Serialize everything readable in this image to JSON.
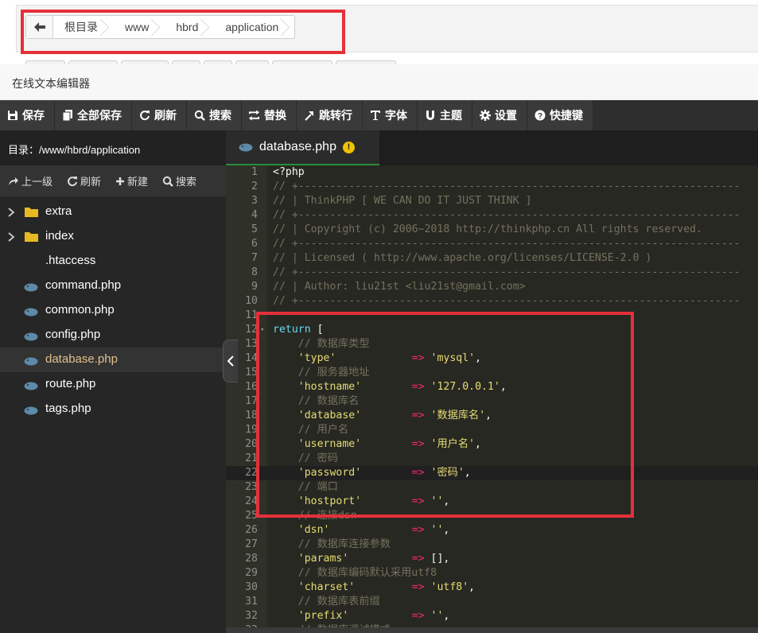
{
  "breadcrumb": {
    "items": [
      "根目录",
      "www",
      "hbrd",
      "application"
    ]
  },
  "window": {
    "title": "在线文本编辑器"
  },
  "toolbar": {
    "buttons": [
      {
        "label": "保存",
        "icon": "floppy-icon"
      },
      {
        "label": "全部保存",
        "icon": "files-icon"
      },
      {
        "label": "刷新",
        "icon": "refresh-icon"
      },
      {
        "label": "搜索",
        "icon": "search-icon"
      },
      {
        "label": "替换",
        "icon": "replace-icon"
      },
      {
        "label": "跳转行",
        "icon": "jump-icon"
      },
      {
        "label": "字体",
        "icon": "font-icon"
      },
      {
        "label": "主题",
        "icon": "magnet-icon"
      },
      {
        "label": "设置",
        "icon": "gear-icon"
      },
      {
        "label": "快捷键",
        "icon": "help-icon"
      }
    ]
  },
  "sidebar": {
    "path": "目录：/www/hbrd/application",
    "actions": [
      {
        "label": "上一级",
        "icon": "share-icon"
      },
      {
        "label": "刷新",
        "icon": "refresh-icon"
      },
      {
        "label": "新建",
        "icon": "plus-icon"
      },
      {
        "label": "搜索",
        "icon": "search-icon"
      }
    ],
    "files": [
      {
        "name": "extra",
        "type": "folder",
        "active": false
      },
      {
        "name": "index",
        "type": "folder",
        "active": false
      },
      {
        "name": ".htaccess",
        "type": "file",
        "active": false
      },
      {
        "name": "command.php",
        "type": "php",
        "active": false
      },
      {
        "name": "common.php",
        "type": "php",
        "active": false
      },
      {
        "name": "config.php",
        "type": "php",
        "active": false
      },
      {
        "name": "database.php",
        "type": "php",
        "active": true
      },
      {
        "name": "route.php",
        "type": "php",
        "active": false
      },
      {
        "name": "tags.php",
        "type": "php",
        "active": false
      }
    ]
  },
  "editor": {
    "tab_name": "database.php",
    "current_line": 22,
    "lines": [
      {
        "n": 1,
        "fold": false,
        "tokens": [
          {
            "t": "pl",
            "v": "<?php"
          }
        ]
      },
      {
        "n": 2,
        "fold": false,
        "tokens": [
          {
            "t": "com",
            "v": "// +----------------------------------------------------------------------"
          }
        ]
      },
      {
        "n": 3,
        "fold": false,
        "tokens": [
          {
            "t": "com",
            "v": "// | ThinkPHP [ WE CAN DO IT JUST THINK ]"
          }
        ]
      },
      {
        "n": 4,
        "fold": false,
        "tokens": [
          {
            "t": "com",
            "v": "// +----------------------------------------------------------------------"
          }
        ]
      },
      {
        "n": 5,
        "fold": false,
        "tokens": [
          {
            "t": "com",
            "v": "// | Copyright (c) 2006~2018 http://thinkphp.cn All rights reserved."
          }
        ]
      },
      {
        "n": 6,
        "fold": false,
        "tokens": [
          {
            "t": "com",
            "v": "// +----------------------------------------------------------------------"
          }
        ]
      },
      {
        "n": 7,
        "fold": false,
        "tokens": [
          {
            "t": "com",
            "v": "// | Licensed ( http://www.apache.org/licenses/LICENSE-2.0 )"
          }
        ]
      },
      {
        "n": 8,
        "fold": false,
        "tokens": [
          {
            "t": "com",
            "v": "// +----------------------------------------------------------------------"
          }
        ]
      },
      {
        "n": 9,
        "fold": false,
        "tokens": [
          {
            "t": "com",
            "v": "// | Author: liu21st <liu21st@gmail.com>"
          }
        ]
      },
      {
        "n": 10,
        "fold": false,
        "tokens": [
          {
            "t": "com",
            "v": "// +----------------------------------------------------------------------"
          }
        ]
      },
      {
        "n": 11,
        "fold": false,
        "tokens": []
      },
      {
        "n": 12,
        "fold": true,
        "tokens": [
          {
            "t": "kw",
            "v": "return"
          },
          {
            "t": "pl",
            "v": " ["
          }
        ]
      },
      {
        "n": 13,
        "fold": false,
        "tokens": [
          {
            "t": "com",
            "v": "    // 数据库类型"
          }
        ]
      },
      {
        "n": 14,
        "fold": false,
        "tokens": [
          {
            "t": "str",
            "v": "    'type'"
          },
          {
            "t": "pl",
            "v": "            "
          },
          {
            "t": "op",
            "v": "=>"
          },
          {
            "t": "pl",
            "v": " "
          },
          {
            "t": "str",
            "v": "'mysql'"
          },
          {
            "t": "pl",
            "v": ","
          }
        ]
      },
      {
        "n": 15,
        "fold": false,
        "tokens": [
          {
            "t": "com",
            "v": "    // 服务器地址"
          }
        ]
      },
      {
        "n": 16,
        "fold": false,
        "tokens": [
          {
            "t": "str",
            "v": "    'hostname'"
          },
          {
            "t": "pl",
            "v": "        "
          },
          {
            "t": "op",
            "v": "=>"
          },
          {
            "t": "pl",
            "v": " "
          },
          {
            "t": "str",
            "v": "'127.0.0.1'"
          },
          {
            "t": "pl",
            "v": ","
          }
        ]
      },
      {
        "n": 17,
        "fold": false,
        "tokens": [
          {
            "t": "com",
            "v": "    // 数据库名"
          }
        ]
      },
      {
        "n": 18,
        "fold": false,
        "tokens": [
          {
            "t": "str",
            "v": "    'database'"
          },
          {
            "t": "pl",
            "v": "        "
          },
          {
            "t": "op",
            "v": "=>"
          },
          {
            "t": "pl",
            "v": " "
          },
          {
            "t": "str",
            "v": "'数据库名'"
          },
          {
            "t": "pl",
            "v": ","
          }
        ]
      },
      {
        "n": 19,
        "fold": false,
        "tokens": [
          {
            "t": "com",
            "v": "    // 用户名"
          }
        ]
      },
      {
        "n": 20,
        "fold": false,
        "tokens": [
          {
            "t": "str",
            "v": "    'username'"
          },
          {
            "t": "pl",
            "v": "        "
          },
          {
            "t": "op",
            "v": "=>"
          },
          {
            "t": "pl",
            "v": " "
          },
          {
            "t": "str",
            "v": "'用户名'"
          },
          {
            "t": "pl",
            "v": ","
          }
        ]
      },
      {
        "n": 21,
        "fold": false,
        "tokens": [
          {
            "t": "com",
            "v": "    // 密码"
          }
        ]
      },
      {
        "n": 22,
        "fold": false,
        "tokens": [
          {
            "t": "str",
            "v": "    'password'"
          },
          {
            "t": "pl",
            "v": "        "
          },
          {
            "t": "op",
            "v": "=>"
          },
          {
            "t": "pl",
            "v": " "
          },
          {
            "t": "str",
            "v": "'密码'"
          },
          {
            "t": "pl",
            "v": ","
          }
        ]
      },
      {
        "n": 23,
        "fold": false,
        "tokens": [
          {
            "t": "com",
            "v": "    // 端口"
          }
        ]
      },
      {
        "n": 24,
        "fold": false,
        "tokens": [
          {
            "t": "str",
            "v": "    'hostport'"
          },
          {
            "t": "pl",
            "v": "        "
          },
          {
            "t": "op",
            "v": "=>"
          },
          {
            "t": "pl",
            "v": " "
          },
          {
            "t": "str",
            "v": "''"
          },
          {
            "t": "pl",
            "v": ","
          }
        ]
      },
      {
        "n": 25,
        "fold": false,
        "tokens": [
          {
            "t": "com",
            "v": "    // 连接dsn"
          }
        ]
      },
      {
        "n": 26,
        "fold": false,
        "tokens": [
          {
            "t": "str",
            "v": "    'dsn'"
          },
          {
            "t": "pl",
            "v": "             "
          },
          {
            "t": "op",
            "v": "=>"
          },
          {
            "t": "pl",
            "v": " "
          },
          {
            "t": "str",
            "v": "''"
          },
          {
            "t": "pl",
            "v": ","
          }
        ]
      },
      {
        "n": 27,
        "fold": false,
        "tokens": [
          {
            "t": "com",
            "v": "    // 数据库连接参数"
          }
        ]
      },
      {
        "n": 28,
        "fold": false,
        "tokens": [
          {
            "t": "str",
            "v": "    'params'"
          },
          {
            "t": "pl",
            "v": "          "
          },
          {
            "t": "op",
            "v": "=>"
          },
          {
            "t": "pl",
            "v": " [],"
          }
        ]
      },
      {
        "n": 29,
        "fold": false,
        "tokens": [
          {
            "t": "com",
            "v": "    // 数据库编码默认采用utf8"
          }
        ]
      },
      {
        "n": 30,
        "fold": false,
        "tokens": [
          {
            "t": "str",
            "v": "    'charset'"
          },
          {
            "t": "pl",
            "v": "         "
          },
          {
            "t": "op",
            "v": "=>"
          },
          {
            "t": "pl",
            "v": " "
          },
          {
            "t": "str",
            "v": "'utf8'"
          },
          {
            "t": "pl",
            "v": ","
          }
        ]
      },
      {
        "n": 31,
        "fold": false,
        "tokens": [
          {
            "t": "com",
            "v": "    // 数据库表前缀"
          }
        ]
      },
      {
        "n": 32,
        "fold": false,
        "tokens": [
          {
            "t": "str",
            "v": "    'prefix'"
          },
          {
            "t": "pl",
            "v": "          "
          },
          {
            "t": "op",
            "v": "=>"
          },
          {
            "t": "pl",
            "v": " "
          },
          {
            "t": "str",
            "v": "''"
          },
          {
            "t": "pl",
            "v": ","
          }
        ]
      },
      {
        "n": 33,
        "fold": false,
        "tokens": [
          {
            "t": "com",
            "v": "    // 数据库调试模式"
          }
        ]
      }
    ]
  },
  "colors": {
    "highlight": "#e5303a",
    "active_file": "#e2c08d",
    "tab_underline": "#2a8c3c",
    "comment": "#75715e",
    "keyword": "#66d9ef",
    "string": "#e6db74",
    "operator": "#f92672"
  }
}
